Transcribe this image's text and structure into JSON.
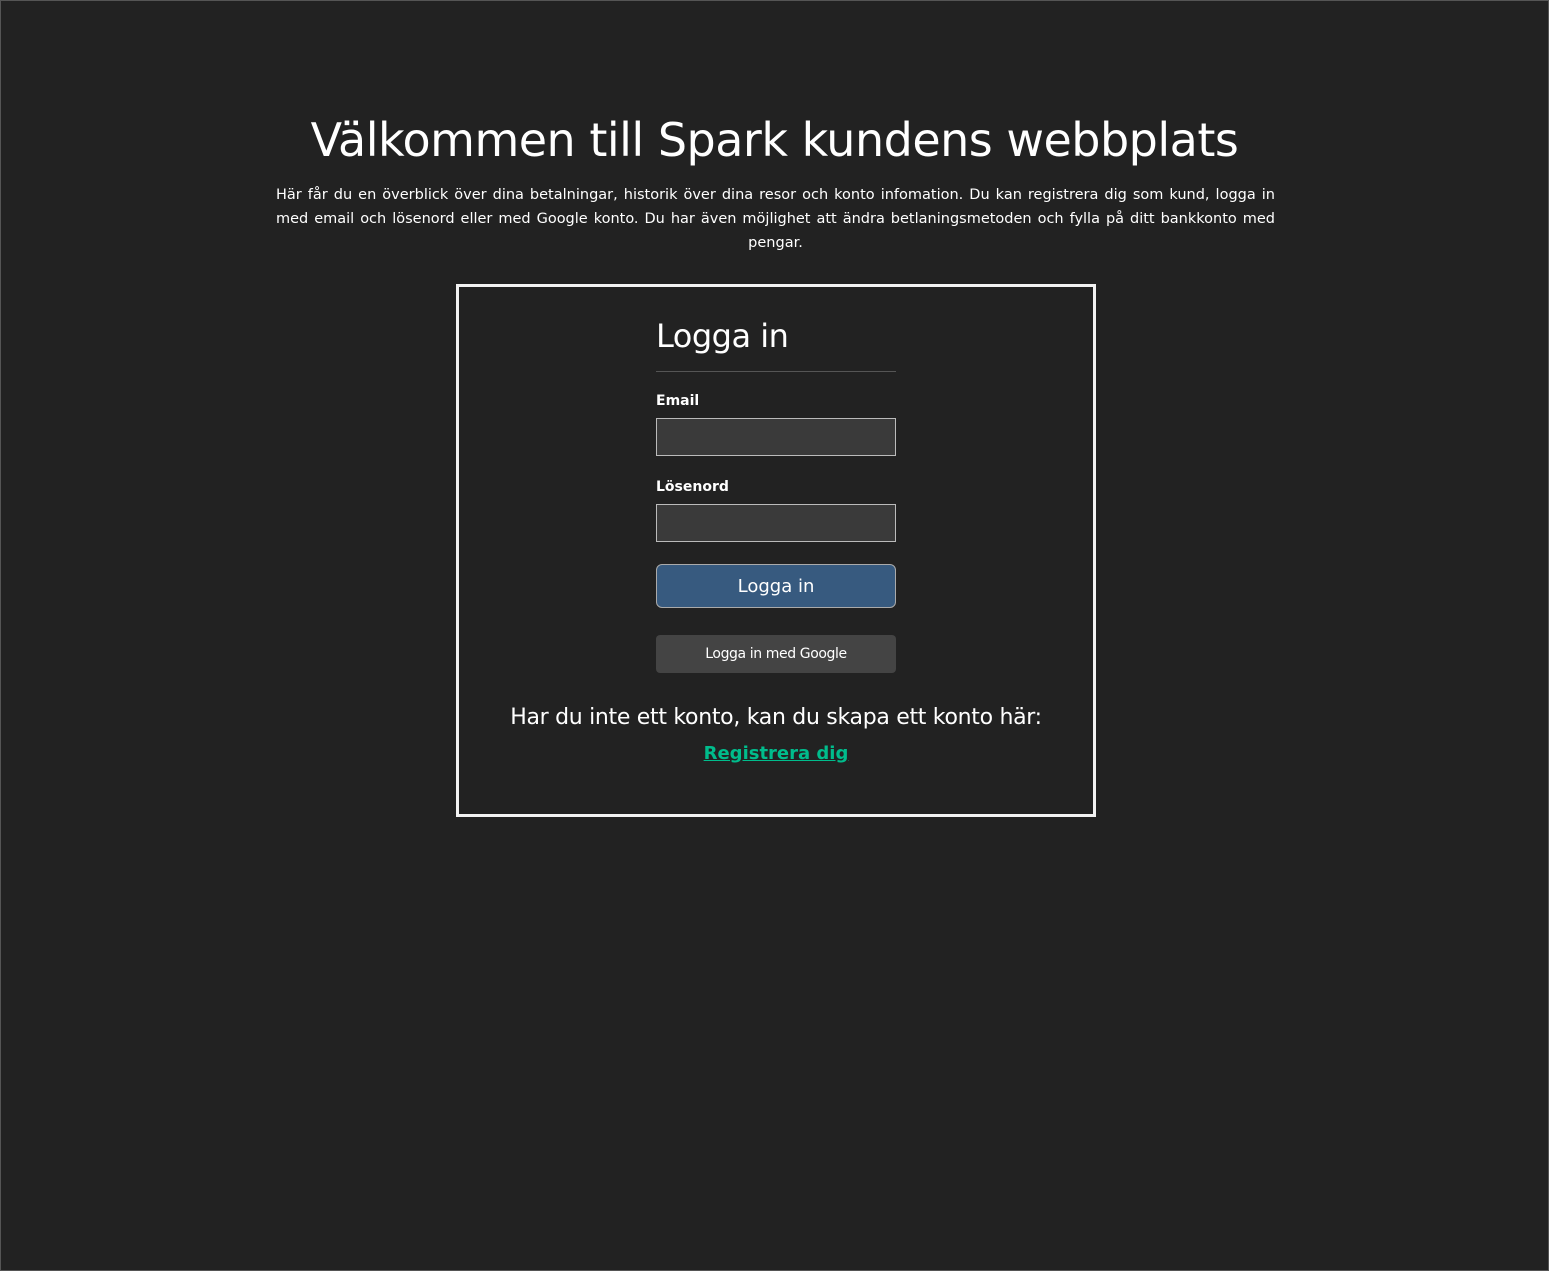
{
  "header": {
    "title": "Välkommen till Spark kundens webbplats",
    "intro": "Här får du en överblick över dina betalningar, historik över dina resor och konto infomation. Du kan registrera dig som kund, logga in med email och lösenord eller med Google konto. Du har även möjlighet att ändra betlaningsmetoden och fylla på ditt bankkonto med pengar."
  },
  "login": {
    "heading": "Logga in",
    "email_label": "Email",
    "email_value": "",
    "password_label": "Lösenord",
    "password_value": "",
    "submit_label": "Logga in",
    "google_label": "Logga in med Google",
    "no_account_text": "Har du inte ett konto, kan du skapa ett konto här:",
    "register_link": "Registrera dig"
  },
  "colors": {
    "background": "#222222",
    "primary_button": "#375a7f",
    "secondary_button": "#444444",
    "link": "#00bc8c"
  }
}
